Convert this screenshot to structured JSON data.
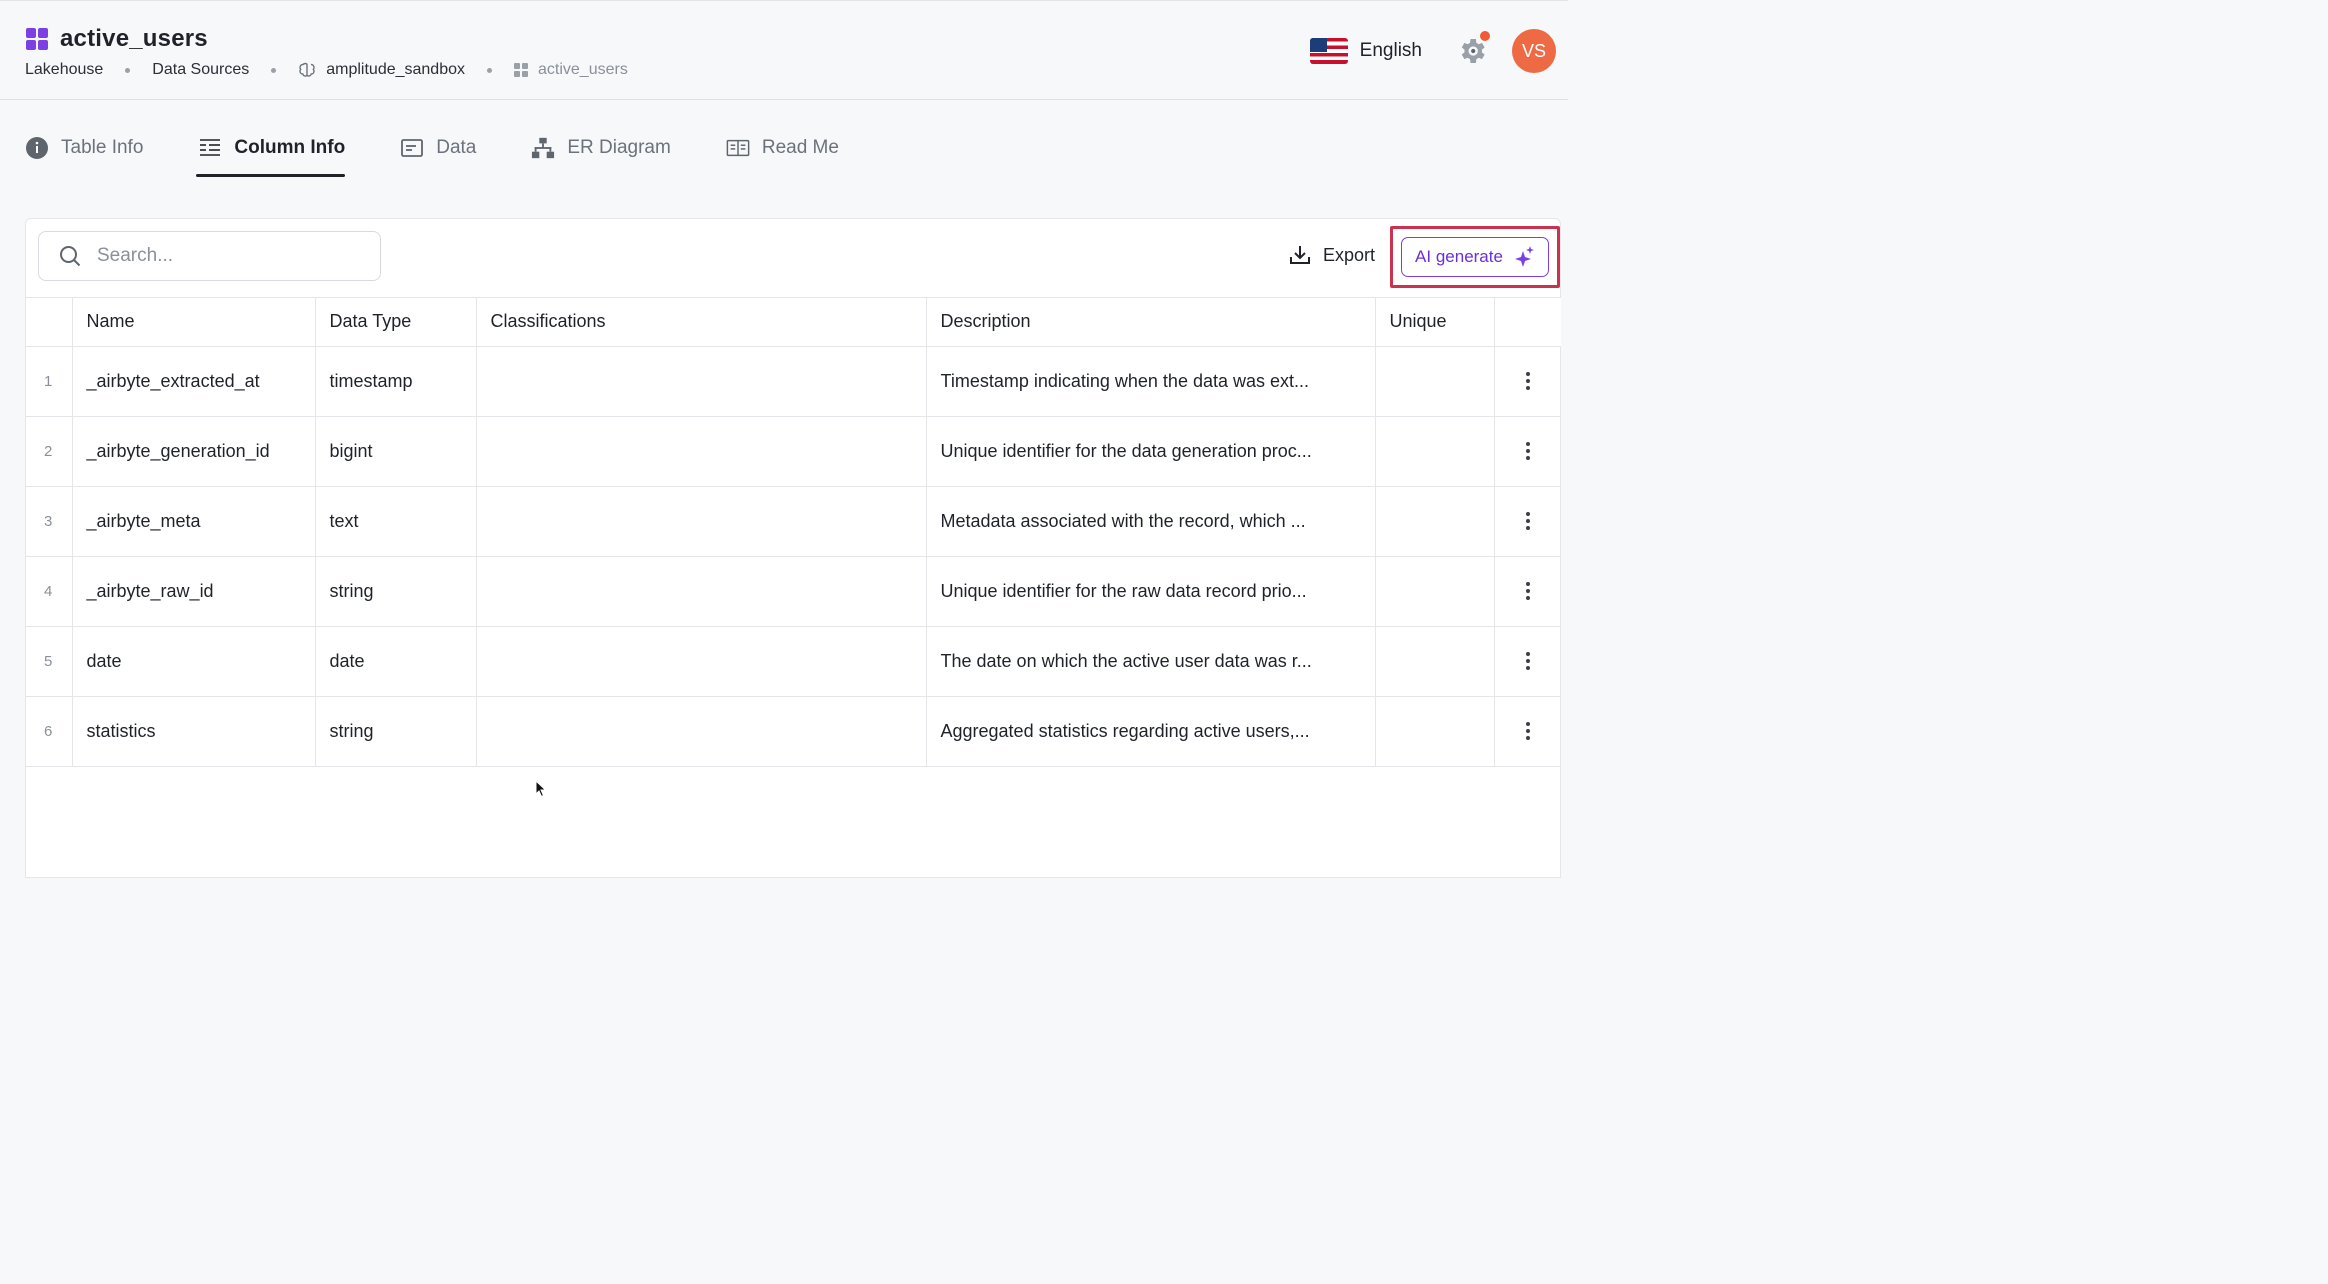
{
  "header": {
    "title": "active_users",
    "breadcrumb": {
      "lakehouse": "Lakehouse",
      "data_sources": "Data Sources",
      "source": "amplitude_sandbox",
      "table": "active_users"
    },
    "language": "English",
    "avatar_initials": "VS",
    "accent_color": "#7b3fe4",
    "notification_color": "#ef5a37"
  },
  "tabs": [
    {
      "label": "Table Info",
      "icon": "info-circle-icon",
      "active": false
    },
    {
      "label": "Column Info",
      "icon": "columns-list-icon",
      "active": true
    },
    {
      "label": "Data",
      "icon": "data-window-icon",
      "active": false
    },
    {
      "label": "ER Diagram",
      "icon": "hierarchy-icon",
      "active": false
    },
    {
      "label": "Read Me",
      "icon": "book-icon",
      "active": false
    }
  ],
  "toolbar": {
    "search_placeholder": "Search...",
    "export_label": "Export",
    "ai_generate_label": "AI generate"
  },
  "table": {
    "columns": [
      "Name",
      "Data Type",
      "Classifications",
      "Description",
      "Unique"
    ],
    "rows": [
      {
        "index": "1",
        "name": "_airbyte_extracted_at",
        "type": "timestamp",
        "classifications": "",
        "description": "Timestamp indicating when the data was ext...",
        "unique": ""
      },
      {
        "index": "2",
        "name": "_airbyte_generation_id",
        "type": "bigint",
        "classifications": "",
        "description": "Unique identifier for the data generation proc...",
        "unique": ""
      },
      {
        "index": "3",
        "name": "_airbyte_meta",
        "type": "text",
        "classifications": "",
        "description": "Metadata associated with the record, which ...",
        "unique": ""
      },
      {
        "index": "4",
        "name": "_airbyte_raw_id",
        "type": "string",
        "classifications": "",
        "description": "Unique identifier for the raw data record prio...",
        "unique": ""
      },
      {
        "index": "5",
        "name": "date",
        "type": "date",
        "classifications": "",
        "description": "The date on which the active user data was r...",
        "unique": ""
      },
      {
        "index": "6",
        "name": "statistics",
        "type": "string",
        "classifications": "",
        "description": "Aggregated statistics regarding active users,...",
        "unique": ""
      }
    ]
  }
}
